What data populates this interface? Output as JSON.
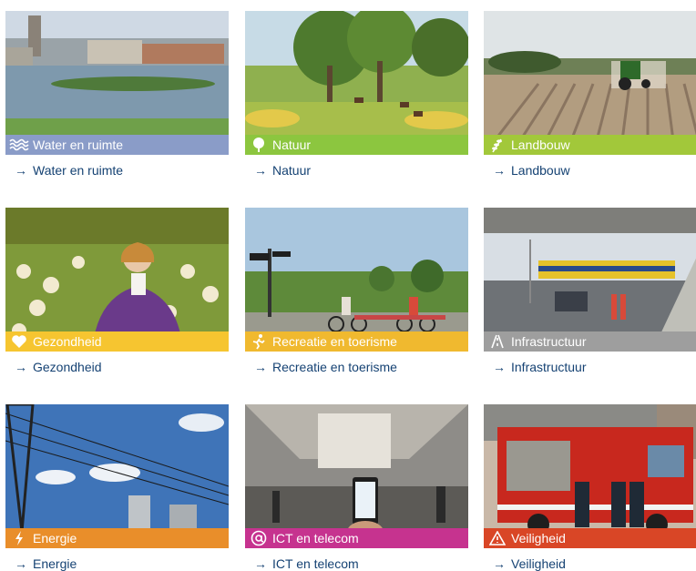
{
  "tiles": [
    {
      "title": "Water en ruimte",
      "link": "Water en ruimte",
      "band_color": "#8a9cc8",
      "icon": "waves-icon"
    },
    {
      "title": "Natuur",
      "link": "Natuur",
      "band_color": "#8cc63f",
      "icon": "tree-icon"
    },
    {
      "title": "Landbouw",
      "link": "Landbouw",
      "band_color": "#a2c83a",
      "icon": "wheat-icon"
    },
    {
      "title": "Gezondheid",
      "link": "Gezondheid",
      "band_color": "#f6c530",
      "icon": "heart-icon"
    },
    {
      "title": "Recreatie en toerisme",
      "link": "Recreatie en toerisme",
      "band_color": "#f0b92f",
      "icon": "runner-icon"
    },
    {
      "title": "Infrastructuur",
      "link": "Infrastructuur",
      "band_color": "#9e9e9e",
      "icon": "road-icon"
    },
    {
      "title": "Energie",
      "link": "Energie",
      "band_color": "#e98e2a",
      "icon": "lightning-icon"
    },
    {
      "title": "ICT en telecom",
      "link": "ICT en telecom",
      "band_color": "#c6338f",
      "icon": "at-sign-icon"
    },
    {
      "title": "Veiligheid",
      "link": "Veiligheid",
      "band_color": "#d94626",
      "icon": "warning-icon"
    }
  ],
  "link_arrow": "→"
}
